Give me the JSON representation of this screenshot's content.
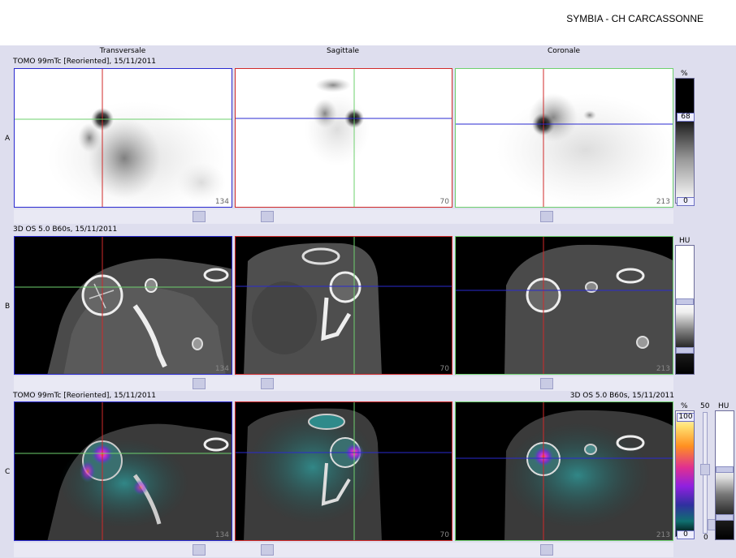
{
  "header": {
    "title": "SYMBIA - CH CARCASSONNE"
  },
  "columns": {
    "transversal": "Transversale",
    "sagittal": "Sagittale",
    "coronal": "Coronale"
  },
  "rows": {
    "a": {
      "letter": "A",
      "caption": "TOMO 99mTc [Reoriented], 15/11/2011"
    },
    "b": {
      "letter": "B",
      "caption": "3D  OS  5.0  B60s, 15/11/2011"
    },
    "c": {
      "letter": "C",
      "caption_left": "TOMO 99mTc [Reoriented], 15/11/2011",
      "caption_right": "3D  OS  5.0  B60s, 15/11/2011"
    }
  },
  "slices": {
    "transversal": "134",
    "sagittal": "70",
    "coronal": "213"
  },
  "colorbars": {
    "a": {
      "unit": "%",
      "upper": "68",
      "lower": "0"
    },
    "b": {
      "unit": "HU"
    },
    "c": {
      "unit": "%",
      "upper": "100",
      "lower": "0",
      "blend": "50",
      "blend_low": "0",
      "ct_unit": "HU"
    }
  },
  "colors": {
    "crosshair_red": "#d02a2a",
    "crosshair_green": "#6ed06e",
    "crosshair_blue": "#2a2ad0",
    "panel_bg": "#dedeee"
  }
}
